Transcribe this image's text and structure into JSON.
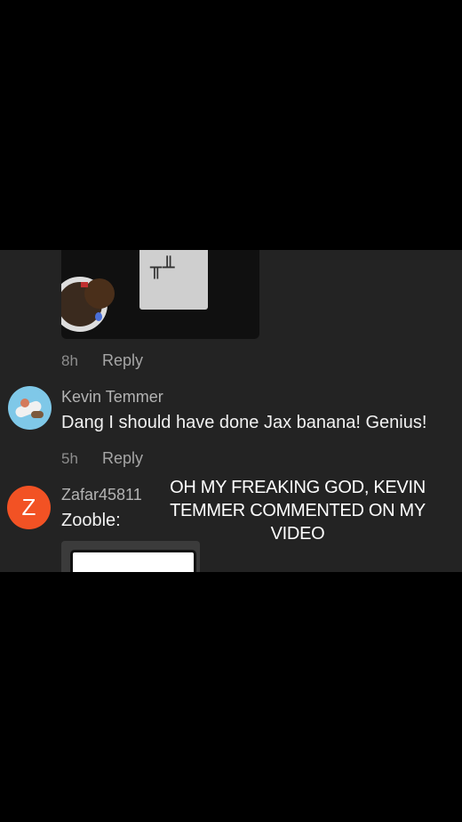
{
  "comments": [
    {
      "time": "8h",
      "reply_label": "Reply"
    },
    {
      "username": "Kevin Temmer",
      "text": "Dang I should have done Jax banana! Genius!",
      "time": "5h",
      "reply_label": "Reply"
    },
    {
      "avatar_letter": "Z",
      "username": "Zafar45811",
      "text": "Zooble:"
    }
  ],
  "caption": "OH MY FREAKING GOD, KEVIN TEMMER COMMENTED ON MY VIDEO",
  "colors": {
    "background": "#000000",
    "panel": "#232323",
    "avatar_z": "#f25224"
  }
}
